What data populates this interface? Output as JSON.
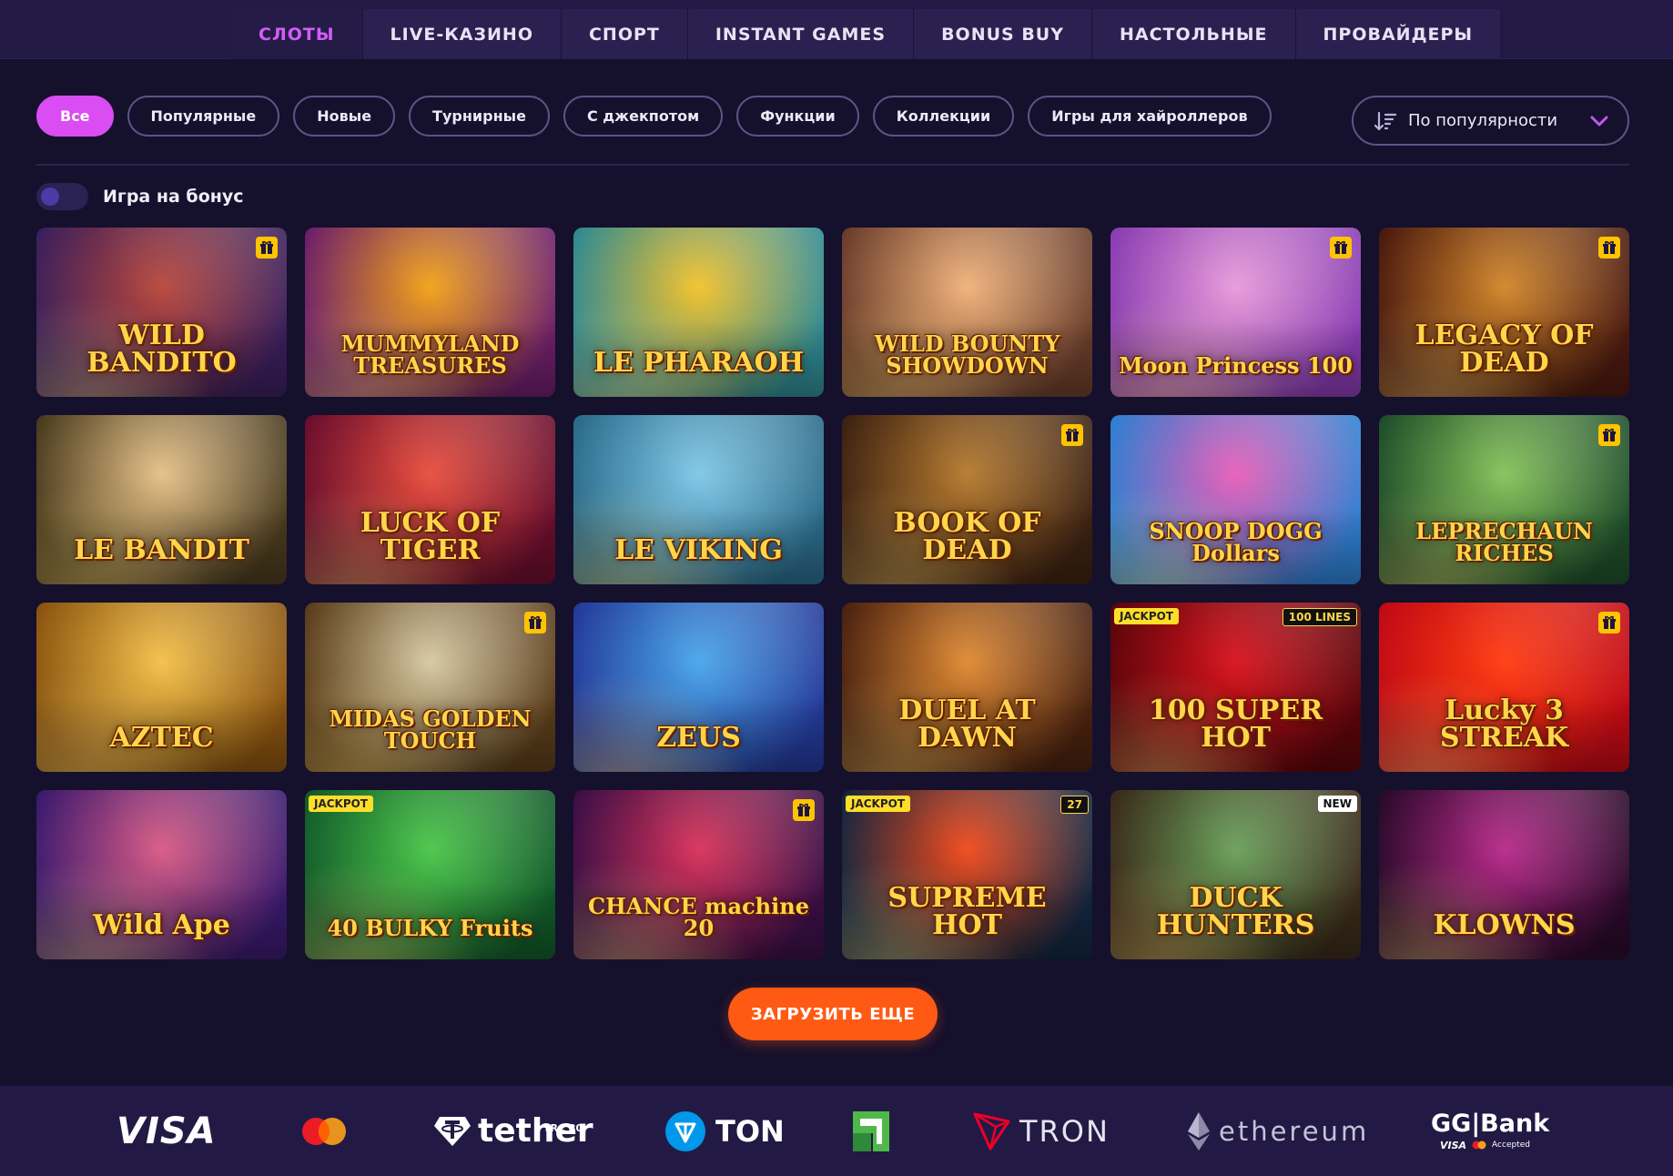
{
  "nav": {
    "tabs": [
      {
        "label": "СЛОТЫ",
        "active": true
      },
      {
        "label": "LIVE-КАЗИНО"
      },
      {
        "label": "СПОРТ"
      },
      {
        "label": "INSTANT GAMES"
      },
      {
        "label": "BONUS BUY"
      },
      {
        "label": "НАСТОЛЬНЫЕ"
      },
      {
        "label": "ПРОВАЙДЕРЫ"
      }
    ]
  },
  "filters": {
    "chips": [
      "Все",
      "Популярные",
      "Новые",
      "Турнирные",
      "С джекпотом",
      "Функции",
      "Коллекции",
      "Игры для хайроллеров"
    ],
    "active_index": 0,
    "sort_label": "По популярности"
  },
  "bonus_toggle": {
    "label": "Игра на бонус",
    "checked": false
  },
  "games": [
    {
      "title": "WILD BANDITO",
      "gift": true,
      "bg": [
        "#b8473b",
        "#3a1f5c"
      ]
    },
    {
      "title": "MUMMYLAND TREASURES",
      "gift": false,
      "bg": [
        "#f2a218",
        "#6d1f6a"
      ]
    },
    {
      "title": "LE PHARAOH",
      "gift": false,
      "bg": [
        "#f3c22c",
        "#2f8a92"
      ]
    },
    {
      "title": "WILD BOUNTY SHOWDOWN",
      "gift": false,
      "bg": [
        "#f0b27a",
        "#6a3d2b"
      ]
    },
    {
      "title": "Moon Princess 100",
      "gift": true,
      "bg": [
        "#e79bd9",
        "#8a3cb2"
      ]
    },
    {
      "title": "LEGACY OF DEAD",
      "gift": true,
      "bg": [
        "#d2862a",
        "#4b1a0f"
      ]
    },
    {
      "title": "LE BANDIT",
      "gift": false,
      "bg": [
        "#e6c188",
        "#4a3b1e"
      ]
    },
    {
      "title": "LUCK OF TIGER",
      "gift": false,
      "bg": [
        "#e84e3e",
        "#6a0e2d"
      ]
    },
    {
      "title": "LE VIKING",
      "gift": false,
      "bg": [
        "#7fc7e6",
        "#2b6b8a"
      ]
    },
    {
      "title": "BOOK OF DEAD",
      "gift": true,
      "bg": [
        "#b67a2f",
        "#3d2212"
      ]
    },
    {
      "title": "SNOOP DOGG Dollars",
      "gift": false,
      "bg": [
        "#e85fb8",
        "#2f7fd1"
      ]
    },
    {
      "title": "LEPRECHAUN RICHES",
      "gift": true,
      "bg": [
        "#86c35b",
        "#1f4e2a"
      ]
    },
    {
      "title": "AZTEC",
      "gift": false,
      "bg": [
        "#f3c04a",
        "#8a5410"
      ]
    },
    {
      "title": "MIDAS GOLDEN TOUCH",
      "gift": true,
      "bg": [
        "#d7c9a2",
        "#5a3d1a"
      ]
    },
    {
      "title": "ZEUS",
      "gift": false,
      "bg": [
        "#4aa6ea",
        "#243a9a"
      ]
    },
    {
      "title": "DUEL AT DAWN",
      "gift": false,
      "bg": [
        "#e08a33",
        "#4a2210"
      ]
    },
    {
      "title": "100 SUPER HOT",
      "gift": false,
      "badge_left": "JACKPOT",
      "badge_right": "100 LINES",
      "bg": [
        "#d8131d",
        "#5a050b"
      ]
    },
    {
      "title": "Lucky 3 STREAK",
      "gift": true,
      "bg": [
        "#ff3c12",
        "#c10a15"
      ]
    },
    {
      "title": "Wild Ape",
      "gift": false,
      "bg": [
        "#d85a85",
        "#3a1a6e"
      ]
    },
    {
      "title": "40 BULKY Fruits",
      "gift": false,
      "badge_left": "JACKPOT",
      "bg": [
        "#4bc64a",
        "#125a2a"
      ]
    },
    {
      "title": "CHANCE machine 20",
      "gift": true,
      "bg": [
        "#d8325a",
        "#3a0f45"
      ]
    },
    {
      "title": "SUPREME HOT",
      "gift": false,
      "badge_left": "JACKPOT",
      "badge_right": "27",
      "bg": [
        "#f04a1c",
        "#13263f"
      ]
    },
    {
      "title": "DUCK HUNTERS",
      "gift": false,
      "badge_right": "NEW",
      "bg": [
        "#6aa05a",
        "#3a2a1a"
      ]
    },
    {
      "title": "KLOWNS",
      "gift": false,
      "bg": [
        "#b82a8a",
        "#2a0a2a"
      ]
    }
  ],
  "load_more_label": "ЗАГРУЗИТЬ ЕЩЕ",
  "payments": {
    "visa": "VISA",
    "tether": "tether",
    "tether_tag": "TRC 20",
    "ton": "TON",
    "tron": "TRON",
    "ethereum": "ethereum",
    "ggbank": "GG|Bank",
    "ggbank_sub1": "VISA",
    "ggbank_sub2": "Accepted"
  },
  "colors": {
    "accent": "#d94df2",
    "cta": "#ff5a14",
    "background": "#15102c",
    "nav": "#221a44"
  }
}
